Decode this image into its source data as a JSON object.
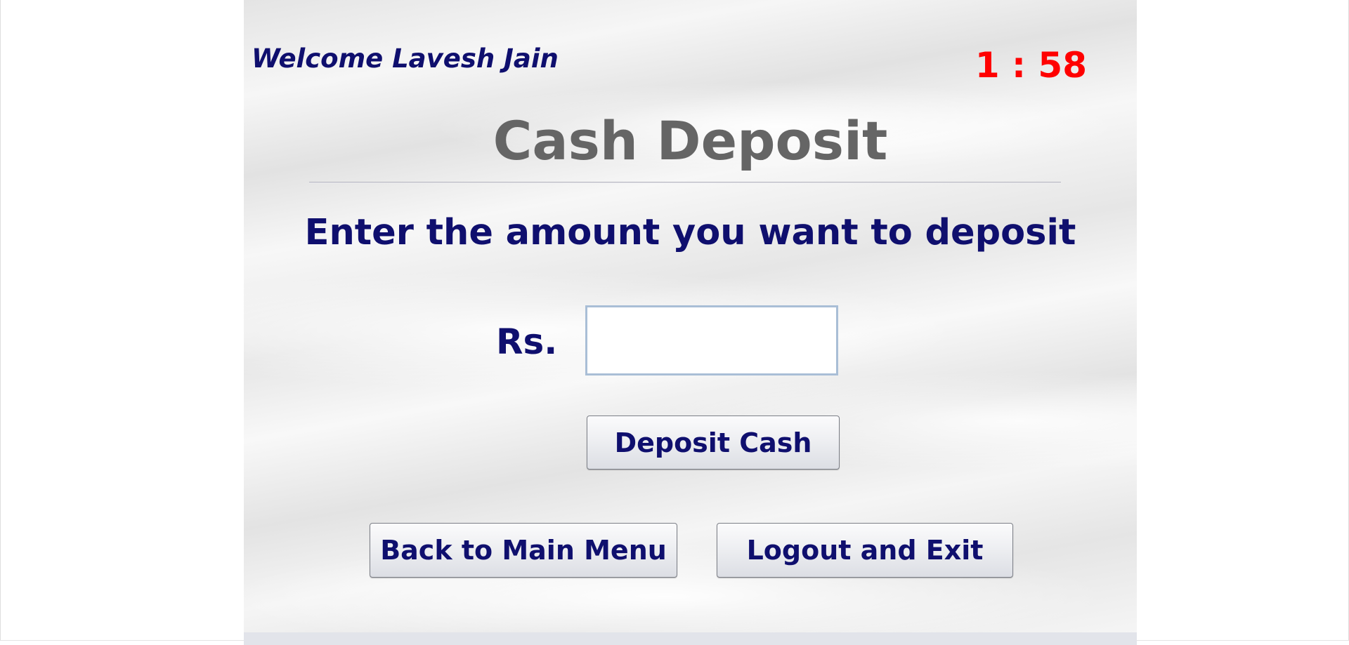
{
  "header": {
    "welcome_text": "Welcome Lavesh Jain",
    "timer": "1 : 58"
  },
  "main": {
    "title": "Cash Deposit",
    "instruction": "Enter the amount you want to deposit",
    "amount_label": "Rs.",
    "amount_value": "",
    "deposit_button_label": "Deposit Cash"
  },
  "footer_actions": {
    "back_button_label": "Back to Main Menu",
    "logout_button_label": "Logout and Exit"
  },
  "colors": {
    "text_navy": "#0f0f6e",
    "title_gray": "#656565",
    "timer_red": "#ff0000",
    "input_border": "#a9bed6"
  }
}
